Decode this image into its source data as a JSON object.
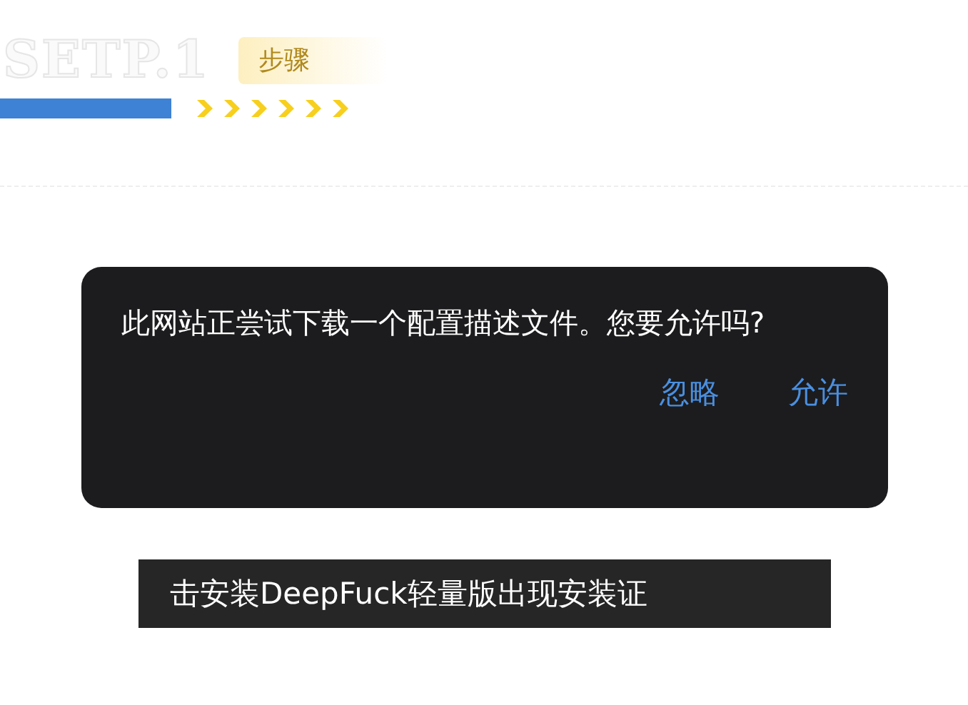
{
  "header": {
    "step": "SETP.1",
    "badge": "步骤"
  },
  "dialog": {
    "message": "此网站正尝试下载一个配置描述文件。您要允许吗?",
    "buttons": [
      "忽略",
      "允许"
    ]
  },
  "caption": "击安装DeepFuck轻量版出现安装证"
}
